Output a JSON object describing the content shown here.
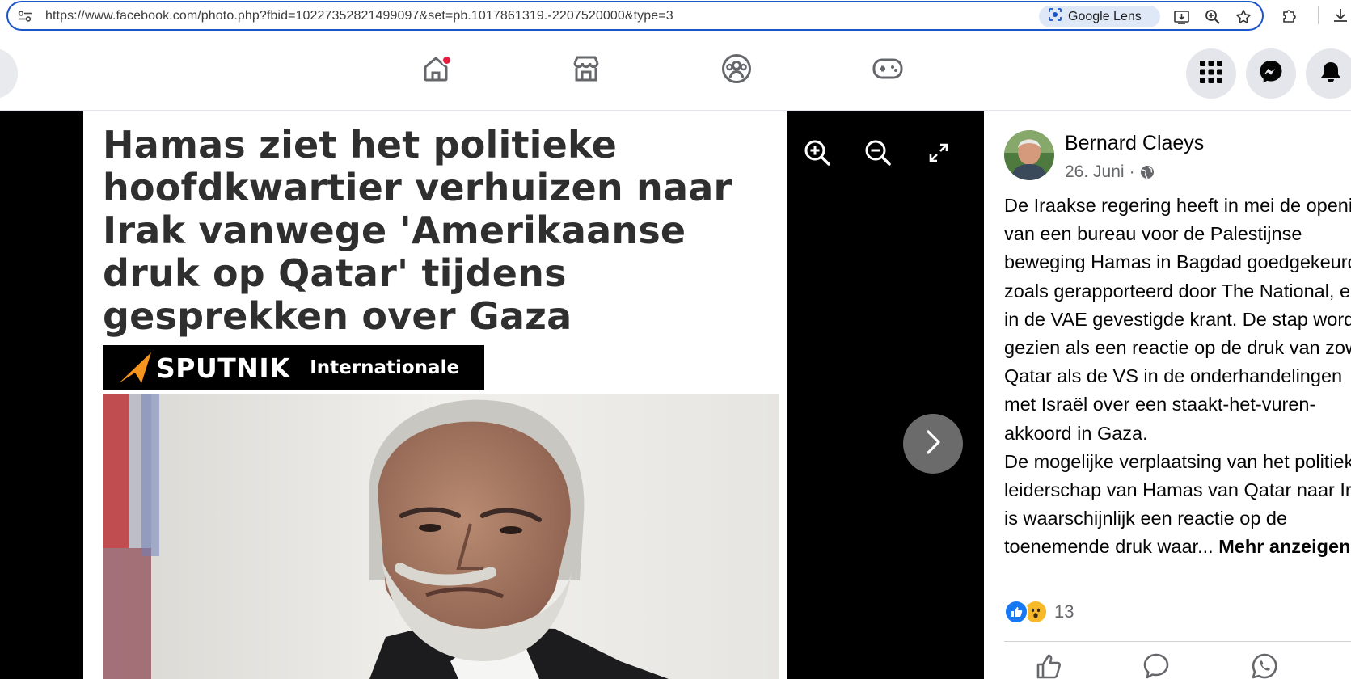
{
  "browser": {
    "url": "https://www.facebook.com/photo.php?fbid=10227352821499097&set=pb.1017861319.-2207520000&type=3",
    "lens_label": "Google Lens"
  },
  "nav": {
    "accent": "#1877f2",
    "notification_dot_color": "#e41e3f"
  },
  "photo": {
    "headline": "Hamas ziet het politieke hoofdkwartier verhuizen naar Irak vanwege 'Amerikaanse druk op Qatar' tijdens gesprekken over Gaza",
    "brand_name": "SPUTNIK",
    "brand_subtitle": "Internationale",
    "brand_accent": "#f7941d"
  },
  "post": {
    "author": "Bernard Claeys",
    "date": "26. Juni",
    "date_separator": "·",
    "text": "De Iraakse regering heeft in mei de opening\nvan een bureau voor de Palestijnse\nbeweging Hamas in Bagdad goedgekeurd,\nzoals gerapporteerd door The National, een\nin de VAE gevestigde krant. De stap wordt\ngezien als een reactie op de druk van zowel\nQatar als de VS in de onderhandelingen\nmet Israël over een staakt-het-vuren-\nakkoord in Gaza.\nDe mogelijke verplaatsing van het politieke\nleiderschap van Hamas van Qatar naar Irak\nis waarschijnlijk een reactie op de\ntoenemende druk waar... ",
    "more_label": "Mehr anzeigen",
    "reaction_count": "13"
  }
}
